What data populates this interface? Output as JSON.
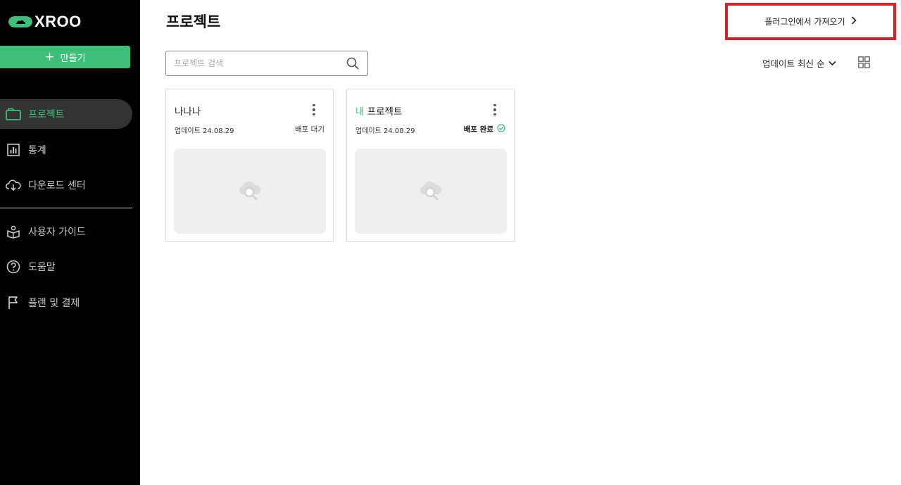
{
  "brand": {
    "name": "XROO",
    "accent": "#3fbf7a"
  },
  "sidebar": {
    "create_label": "만들기",
    "items": [
      {
        "label": "프로젝트",
        "icon": "folder-icon",
        "active": true
      },
      {
        "label": "통계",
        "icon": "bar-chart-icon"
      },
      {
        "label": "다운로드 센터",
        "icon": "cloud-download-icon"
      },
      {
        "label": "사용자 가이드",
        "icon": "guide-book-icon"
      },
      {
        "label": "도움말",
        "icon": "help-circle-icon"
      },
      {
        "label": "플랜 및 결제",
        "icon": "flag-icon"
      }
    ]
  },
  "header": {
    "title": "프로젝트",
    "import_label": "플러그인에서 가져오기",
    "import_highlight_color": "#d3232a"
  },
  "search": {
    "placeholder": "프로젝트 검색",
    "value": ""
  },
  "sort": {
    "label": "업데이트 최신 순"
  },
  "projects": [
    {
      "title": "나나나",
      "title_accent": "",
      "date": "업데이트 24.08.29",
      "status": "배포 대기",
      "status_icon": ""
    },
    {
      "title": "프로젝트",
      "title_accent": "내 ",
      "date": "업데이트 24.08.29",
      "status": "배포 완료",
      "status_icon": "check-circle-icon"
    }
  ]
}
